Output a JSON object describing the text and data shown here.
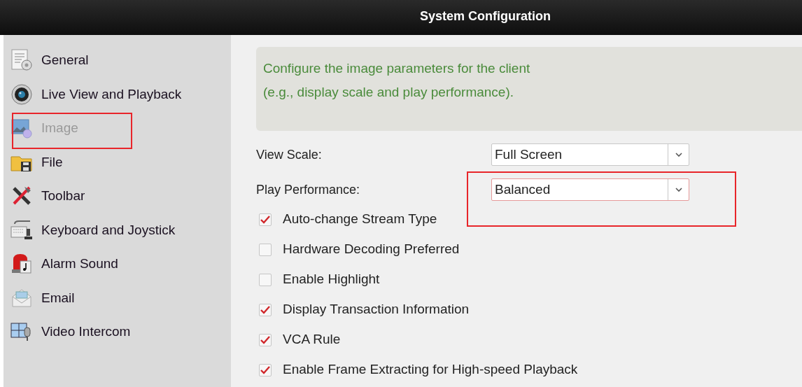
{
  "window": {
    "title": "System Configuration"
  },
  "sidebar": {
    "items": [
      {
        "label": "General",
        "kind": "general",
        "selected": false,
        "highlighted": false
      },
      {
        "label": "Live View and Playback",
        "kind": "camera",
        "selected": false,
        "highlighted": false
      },
      {
        "label": "Image",
        "kind": "image",
        "selected": true,
        "highlighted": true
      },
      {
        "label": "File",
        "kind": "file",
        "selected": false,
        "highlighted": false
      },
      {
        "label": "Toolbar",
        "kind": "toolbar",
        "selected": false,
        "highlighted": false
      },
      {
        "label": "Keyboard and Joystick",
        "kind": "keyboard",
        "selected": false,
        "highlighted": false
      },
      {
        "label": "Alarm Sound",
        "kind": "alarm",
        "selected": false,
        "highlighted": false
      },
      {
        "label": "Email",
        "kind": "email",
        "selected": false,
        "highlighted": false
      },
      {
        "label": "Video Intercom",
        "kind": "intercom",
        "selected": false,
        "highlighted": false
      }
    ]
  },
  "info": {
    "lines": [
      "Configure the image parameters for the client",
      "(e.g., display scale and play performance)."
    ]
  },
  "fields": [
    {
      "label": "View Scale:",
      "value": "Full Screen",
      "highlighted": false
    },
    {
      "label": "Play Performance:",
      "value": "Balanced",
      "highlighted": true
    }
  ],
  "options": [
    {
      "label": "Auto-change Stream Type",
      "checked": true
    },
    {
      "label": "Hardware Decoding Preferred",
      "checked": false
    },
    {
      "label": "Enable Highlight",
      "checked": false
    },
    {
      "label": "Display Transaction Information",
      "checked": true
    },
    {
      "label": "VCA Rule",
      "checked": true
    },
    {
      "label": "Enable Frame Extracting for High-speed Playback",
      "checked": true
    }
  ]
}
